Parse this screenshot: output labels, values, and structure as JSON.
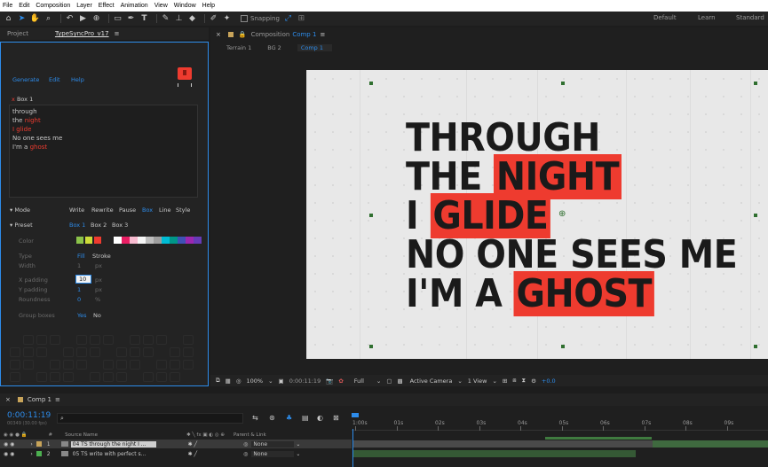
{
  "menu": [
    "File",
    "Edit",
    "Composition",
    "Layer",
    "Effect",
    "Animation",
    "View",
    "Window",
    "Help"
  ],
  "toolbar": {
    "snapping_label": "Snapping",
    "workspaces": [
      "Default",
      "Learn",
      "Standard"
    ]
  },
  "left_panel": {
    "tabs": [
      "Project",
      "TypeSyncPro_v17"
    ],
    "nav": [
      "Generate",
      "Edit",
      "Help"
    ],
    "box_label": "Box 1",
    "box_close": "x",
    "lyrics": [
      {
        "before": "through",
        "red": "",
        "after": ""
      },
      {
        "before": "the ",
        "red": "night",
        "after": ""
      },
      {
        "before": "",
        "red": "I glide",
        "after": ""
      },
      {
        "before": "No one sees me",
        "red": "",
        "after": ""
      },
      {
        "before": "I'm a ",
        "red": "ghost",
        "after": ""
      }
    ],
    "mode": {
      "label": "Mode",
      "options": [
        "Write",
        "Rewrite",
        "Pause",
        "Box",
        "Line",
        "Style"
      ],
      "active": "Box"
    },
    "preset": {
      "label": "Preset",
      "options": [
        "Box 1",
        "Box 2",
        "Box 3"
      ],
      "active": "Box 1"
    },
    "color_label": "Color",
    "swatches": [
      "#8bc34a",
      "#cddc39",
      "#ee3b2f",
      "#ffffff",
      "#e91e63",
      "#f8bbd0",
      "#f5f5f5",
      "#bdbdbd",
      "#9e9e9e",
      "#00bcd4",
      "#009688",
      "#3f51b5",
      "#9c27b0",
      "#673ab7"
    ],
    "type": {
      "label": "Type",
      "options": [
        "Fill",
        "Stroke"
      ],
      "active": "Fill"
    },
    "width": {
      "label": "Width",
      "value": "1",
      "unit": "px"
    },
    "x_padding": {
      "label": "X padding",
      "value": "10",
      "unit": "px"
    },
    "y_padding": {
      "label": "Y padding",
      "value": "1",
      "unit": "px"
    },
    "roundness": {
      "label": "Roundness",
      "value": "0",
      "unit": "%"
    },
    "group_boxes": {
      "label": "Group boxes",
      "options": [
        "Yes",
        "No"
      ],
      "active": "Yes"
    }
  },
  "viewer": {
    "comp_title": "Composition",
    "comp_name": "Comp 1",
    "breadcrumbs": [
      "Terrain 1",
      "BG 2",
      "Comp 1"
    ],
    "lyrics": [
      {
        "before": "THROUGH",
        "red": ""
      },
      {
        "before": "THE ",
        "red": "NIGHT"
      },
      {
        "before": "I ",
        "red": "GLIDE"
      },
      {
        "before": "NO ONE SEES ME",
        "red": ""
      },
      {
        "before": "I'M A ",
        "red": "GHOST"
      }
    ],
    "footer": {
      "zoom": "100%",
      "timecode": "0:00:11:19",
      "resolution": "Full",
      "camera": "Active Camera",
      "views": "1 View",
      "exposure": "+0.0"
    }
  },
  "timeline": {
    "tab": "Comp 1",
    "timecode": "0:00:11:19",
    "fps": "00349 (30.00 fps)",
    "search_placeholder": "",
    "columns": {
      "source": "Source Name",
      "parent": "Parent & Link"
    },
    "ruler": [
      "1:00s",
      "01s",
      "02s",
      "03s",
      "04s",
      "05s",
      "06s",
      "07s",
      "08s",
      "09s"
    ],
    "layers": [
      {
        "num": "1",
        "name": "04 TS through the night I ...",
        "parent": "None"
      },
      {
        "num": "2",
        "name": "05 TS write with perfect s...",
        "parent": "None"
      }
    ]
  }
}
